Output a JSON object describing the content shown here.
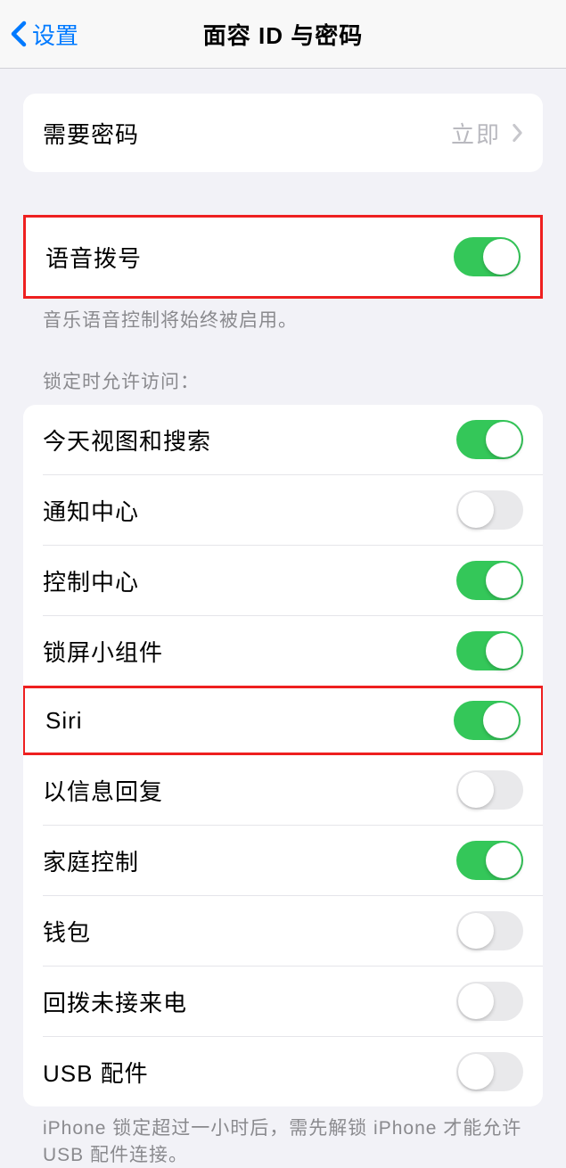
{
  "nav": {
    "back_label": "设置",
    "title": "面容 ID 与密码"
  },
  "require_passcode": {
    "label": "需要密码",
    "value": "立即"
  },
  "voice_dial": {
    "label": "语音拨号",
    "enabled": true,
    "footer": "音乐语音控制将始终被启用。"
  },
  "lock_section": {
    "header": "锁定时允许访问：",
    "items": [
      {
        "label": "今天视图和搜索",
        "enabled": true,
        "highlighted": false
      },
      {
        "label": "通知中心",
        "enabled": false,
        "highlighted": false
      },
      {
        "label": "控制中心",
        "enabled": true,
        "highlighted": false
      },
      {
        "label": "锁屏小组件",
        "enabled": true,
        "highlighted": false
      },
      {
        "label": "Siri",
        "enabled": true,
        "highlighted": true
      },
      {
        "label": "以信息回复",
        "enabled": false,
        "highlighted": false
      },
      {
        "label": "家庭控制",
        "enabled": true,
        "highlighted": false
      },
      {
        "label": "钱包",
        "enabled": false,
        "highlighted": false
      },
      {
        "label": "回拨未接来电",
        "enabled": false,
        "highlighted": false
      },
      {
        "label": "USB 配件",
        "enabled": false,
        "highlighted": false
      }
    ],
    "footer": "iPhone 锁定超过一小时后，需先解锁 iPhone 才能允许 USB 配件连接。"
  }
}
